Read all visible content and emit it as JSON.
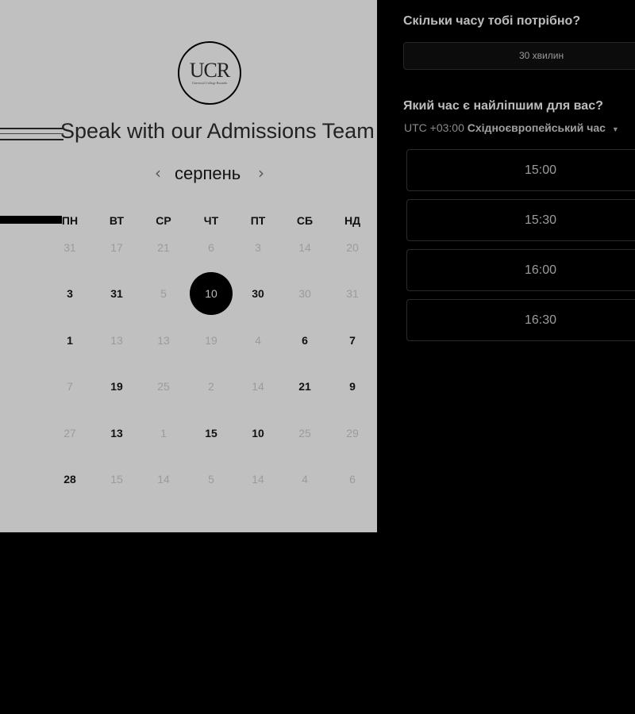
{
  "colors": {
    "left_panel_bg": "#c0c0c0",
    "right_panel_bg": "#000000",
    "selected_day_bg": "#000000"
  },
  "logo": {
    "text": "UCR",
    "subtext": "Universal College Rwanda"
  },
  "heading": "Speak with our Admissions Team",
  "calendar": {
    "month": "серпень",
    "prev_icon": "chevron-left-icon",
    "next_icon": "chevron-right-icon",
    "weekdays": [
      "ПН",
      "ВТ",
      "СР",
      "ЧТ",
      "ПТ",
      "СБ",
      "НД"
    ],
    "weeks": [
      [
        {
          "n": "31",
          "s": "muted"
        },
        {
          "n": "17",
          "s": "muted"
        },
        {
          "n": "21",
          "s": "muted"
        },
        {
          "n": "6",
          "s": "muted"
        },
        {
          "n": "3",
          "s": "muted"
        },
        {
          "n": "14",
          "s": "muted"
        },
        {
          "n": "20",
          "s": "muted"
        }
      ],
      [
        {
          "n": "3",
          "s": "active"
        },
        {
          "n": "31",
          "s": "active"
        },
        {
          "n": "5",
          "s": "muted"
        },
        {
          "n": "10",
          "s": "selected"
        },
        {
          "n": "30",
          "s": "active"
        },
        {
          "n": "30",
          "s": "muted"
        },
        {
          "n": "31",
          "s": "muted"
        }
      ],
      [
        {
          "n": "1",
          "s": "active"
        },
        {
          "n": "13",
          "s": "muted"
        },
        {
          "n": "13",
          "s": "muted"
        },
        {
          "n": "19",
          "s": "muted"
        },
        {
          "n": "4",
          "s": "muted"
        },
        {
          "n": "6",
          "s": "active"
        },
        {
          "n": "7",
          "s": "active"
        }
      ],
      [
        {
          "n": "7",
          "s": "muted"
        },
        {
          "n": "19",
          "s": "active"
        },
        {
          "n": "25",
          "s": "muted"
        },
        {
          "n": "2",
          "s": "muted"
        },
        {
          "n": "14",
          "s": "muted"
        },
        {
          "n": "21",
          "s": "active"
        },
        {
          "n": "9",
          "s": "active"
        }
      ],
      [
        {
          "n": "27",
          "s": "muted"
        },
        {
          "n": "13",
          "s": "active"
        },
        {
          "n": "1",
          "s": "muted"
        },
        {
          "n": "15",
          "s": "active"
        },
        {
          "n": "10",
          "s": "active"
        },
        {
          "n": "25",
          "s": "muted"
        },
        {
          "n": "29",
          "s": "muted"
        }
      ],
      [
        {
          "n": "28",
          "s": "active"
        },
        {
          "n": "15",
          "s": "muted"
        },
        {
          "n": "14",
          "s": "muted"
        },
        {
          "n": "5",
          "s": "muted"
        },
        {
          "n": "14",
          "s": "muted"
        },
        {
          "n": "4",
          "s": "muted"
        },
        {
          "n": "6",
          "s": "muted"
        }
      ]
    ]
  },
  "scheduler": {
    "duration_question": "Скільки часу тобі потрібно?",
    "duration_value": "30 хвилин",
    "time_question": "Який час є найліпшим для вас?",
    "timezone_offset": "UTC +03:00",
    "timezone_name": "Східноєвропейський час",
    "timezone_icon": "caret-down-icon",
    "slots": [
      "15:00",
      "15:30",
      "16:00",
      "16:30"
    ]
  }
}
